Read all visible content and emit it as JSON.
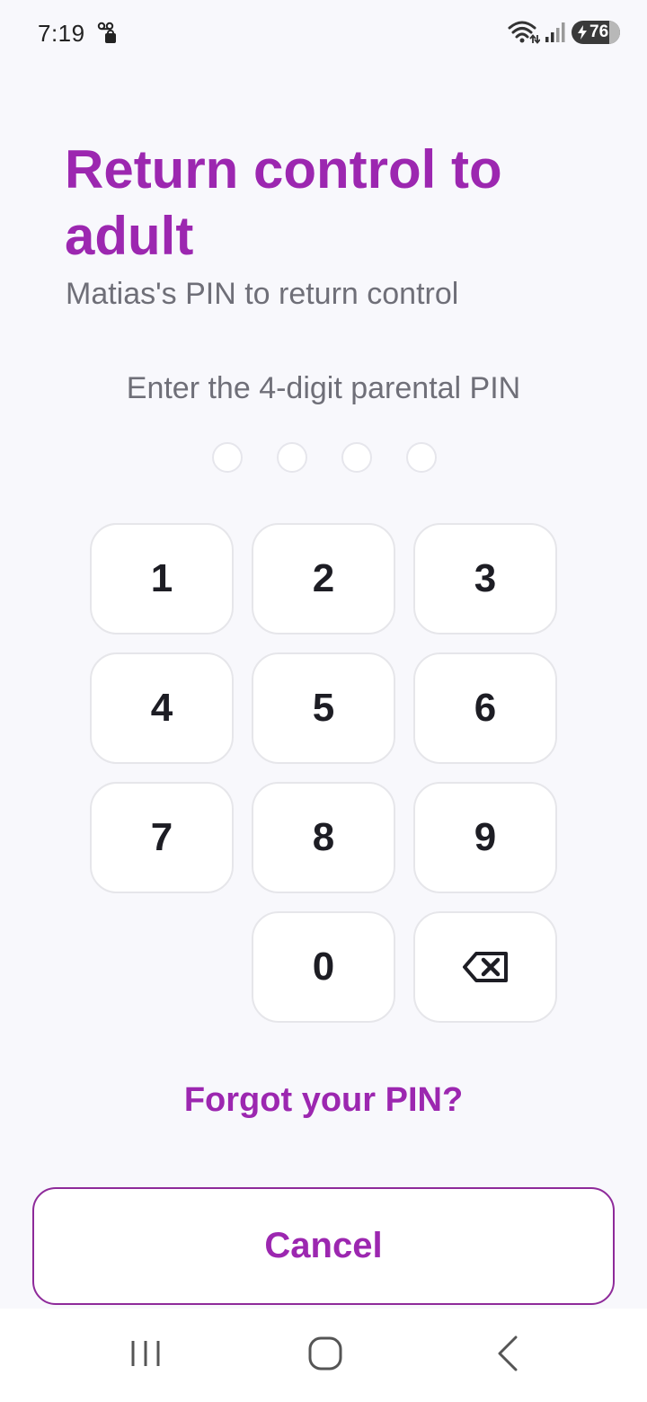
{
  "status_bar": {
    "time": "7:19",
    "battery_level": "76",
    "icons": [
      "notification-icon",
      "wifi-icon",
      "signal-icon",
      "battery-charging-icon"
    ]
  },
  "header": {
    "title": "Return control to adult",
    "subtitle": "Matias's PIN to return control"
  },
  "pin": {
    "prompt": "Enter the 4-digit parental PIN",
    "length": 4,
    "entered": 0
  },
  "keypad": {
    "keys": [
      "1",
      "2",
      "3",
      "4",
      "5",
      "6",
      "7",
      "8",
      "9",
      "0"
    ],
    "backspace_icon": "backspace-icon"
  },
  "links": {
    "forgot_pin": "Forgot your PIN?"
  },
  "actions": {
    "cancel": "Cancel"
  },
  "nav_bar": {
    "icons": [
      "recents-icon",
      "home-icon",
      "back-icon"
    ]
  },
  "colors": {
    "accent": "#9c27b0",
    "background": "#f8f8fc",
    "key_text": "#1d1d24",
    "muted_text": "#6f6f78"
  }
}
